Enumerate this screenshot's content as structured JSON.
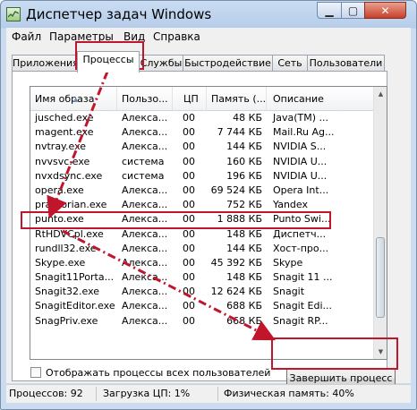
{
  "window": {
    "title": "Диспетчер задач Windows",
    "close_glyph": "✕",
    "min_glyph": "▁",
    "max_glyph": "▢"
  },
  "menu": [
    "Файл",
    "Параметры",
    "Вид",
    "Справка"
  ],
  "tabs": [
    "Приложения",
    "Процессы",
    "Службы",
    "Быстродействие",
    "Сеть",
    "Пользователи"
  ],
  "active_tab": 1,
  "columns": [
    "Имя образа",
    "Пользо...",
    "ЦП",
    "Память (...",
    "Описание"
  ],
  "sort_indicator": "▲",
  "rows": [
    [
      "jusched.exe",
      "Алекса...",
      "00",
      "48 КБ",
      "Java(TM) ..."
    ],
    [
      "magent.exe",
      "Алекса...",
      "00",
      "7 744 КБ",
      "Mail.Ru Ag..."
    ],
    [
      "nvtray.exe",
      "Алекса...",
      "00",
      "144 КБ",
      "NVIDIA S..."
    ],
    [
      "nvvsvc.exe",
      "система",
      "00",
      "160 КБ",
      "NVIDIA U..."
    ],
    [
      "nvxdsync.exe",
      "система",
      "00",
      "196 КБ",
      "NVIDIA U..."
    ],
    [
      "opera.exe",
      "Алекса...",
      "00",
      "69 524 КБ",
      "Opera Int..."
    ],
    [
      "praetorian.exe",
      "Алекса...",
      "00",
      "752 КБ",
      "Yandex"
    ],
    [
      "punto.exe",
      "Алекса...",
      "00",
      "1 888 КБ",
      "Punto Swi..."
    ],
    [
      "RtHDVCpl.exe",
      "Алекса...",
      "00",
      "148 КБ",
      "Диспетч..."
    ],
    [
      "rundll32.exe",
      "Алекса...",
      "00",
      "144 КБ",
      "Хост-про..."
    ],
    [
      "Skype.exe",
      "Алекса...",
      "00",
      "45 392 КБ",
      "Skype"
    ],
    [
      "Snagit11Porta...",
      "Алекса...",
      "00",
      "148 КБ",
      "Snagit 11 ..."
    ],
    [
      "Snagit32.exe",
      "Алекса...",
      "00",
      "12 624 КБ",
      "Snagit"
    ],
    [
      "SnagitEditor.exe",
      "Алекса...",
      "00",
      "688 КБ",
      "Snagit Edi..."
    ],
    [
      "SnagPriv.exe",
      "Алекса...",
      "00",
      "668 КБ",
      "Snagit RP..."
    ]
  ],
  "highlight_row_index": 7,
  "show_all_processes": {
    "label": "Отображать процессы всех пользователей",
    "checked": false
  },
  "end_process_button": "Завершить процесс",
  "status": {
    "processes": "Процессов: 92",
    "cpu": "Загрузка ЦП: 1%",
    "memory": "Физическая память: 40%"
  },
  "annotation_color": "#c0152a"
}
